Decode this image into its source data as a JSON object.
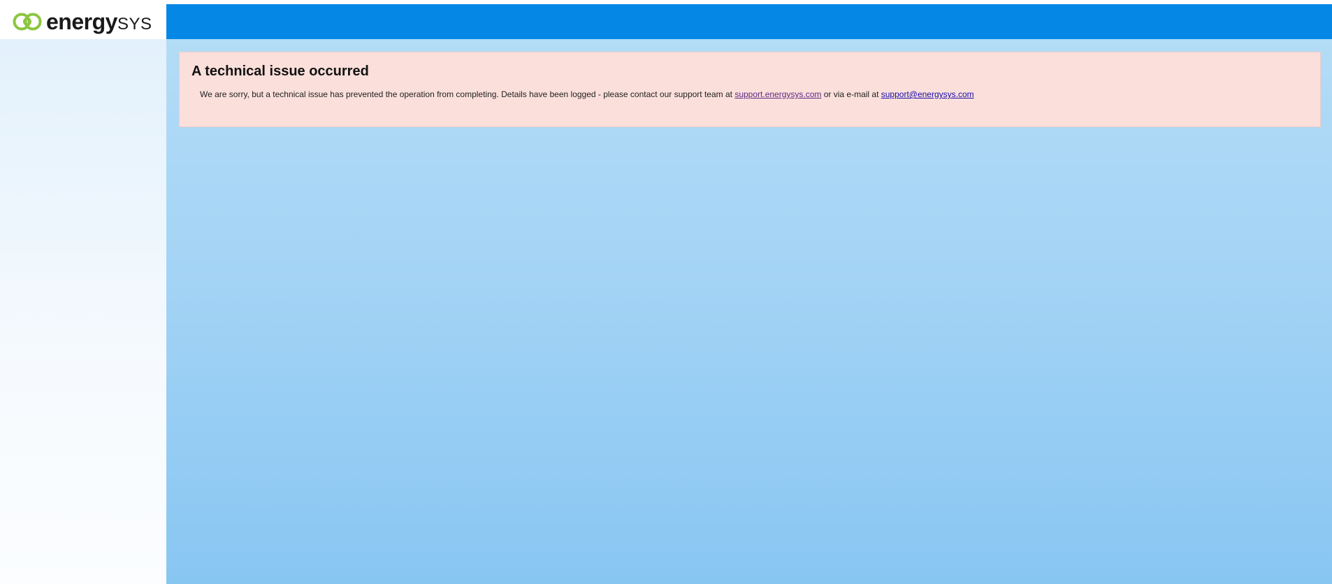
{
  "brand": {
    "name_bold": "energy",
    "name_light": "SYS",
    "logo_icon": "energysys-logo-icon",
    "logo_color": "#8cc63f",
    "header_color": "#0588e5"
  },
  "error": {
    "title": "A technical issue occurred",
    "message_before": "We are sorry, but a technical issue has prevented the operation from completing. Details have been logged - please contact our support team at ",
    "support_link": "support.energysys.com",
    "message_middle": " or via e-mail at ",
    "email_link": "support@energysys.com",
    "background_color": "#fbdfdb"
  }
}
